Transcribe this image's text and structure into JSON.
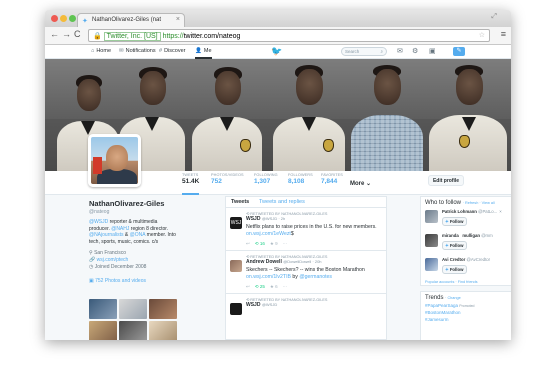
{
  "browser": {
    "tab_title": "NathanOlivarez-Giles (nat",
    "tab_close": "×",
    "back": "←",
    "forward": "→",
    "reload": "C",
    "ev_label": "Twitter, Inc. [US]",
    "url_scheme": "https://",
    "url_rest": "twitter.com/nateog",
    "menu_icon": "≡",
    "colors": {
      "secure": "#2a8d2a"
    }
  },
  "nav": {
    "home": "Home",
    "notifications": "Notifications",
    "discover": "Discover",
    "me": "Me",
    "search_placeholder": "Search"
  },
  "stats": [
    {
      "label": "TWEETS",
      "value": "51.4K"
    },
    {
      "label": "PHOTOS/VIDEOS",
      "value": "752"
    },
    {
      "label": "FOLLOWING",
      "value": "1,307"
    },
    {
      "label": "FOLLOWERS",
      "value": "8,108"
    },
    {
      "label": "FAVORITES",
      "value": "7,844"
    }
  ],
  "more_label": "More",
  "edit_profile": "Edit profile",
  "profile": {
    "name": "NathanOlivarez-Giles",
    "handle": "@nateog",
    "bio_mention1": "@WSJD",
    "bio_text1": " reporter & multimedia producer. ",
    "bio_mention2": "@NAHJ",
    "bio_text2": " region 8 director. ",
    "bio_mention3": "@NAjournalists",
    "bio_text3": " & ",
    "bio_mention4": "@ONA",
    "bio_text4": " member. Into tech, sports, music, comics. c/s",
    "location": "San Francisco",
    "website": "wsj.com/ptech",
    "joined": "Joined December 2008",
    "photos_link": "752 Photos and videos"
  },
  "timeline": {
    "tab_tweets": "Tweets",
    "tab_replies": "Tweets and replies",
    "tweets": [
      {
        "retweet_label": "RETWEETED BY NATHANOLIVAREZ-GILES",
        "name": "WSJD",
        "handle": "@WSJD · 2h",
        "text": "Netflix plans to raise prices in the U.S. for new members. ",
        "link": "on.wsj.com/1eWezt",
        "text_after": "$",
        "rt_count": "16",
        "fav_count": "9"
      },
      {
        "retweet_label": "RETWEETED BY NATHANOLIVAREZ-GILES",
        "name": "Andrew Dowell",
        "handle": "@DowellDowell · 20h",
        "text": "Skechers -- Skechers? -- wins the Boston Marathon ",
        "link": "on.wsj.com/1lv2TIB",
        "text_after": " by ",
        "mention": "@germanotes",
        "rt_count": "25",
        "fav_count": "6"
      },
      {
        "retweet_label": "RETWEETED BY NATHANOLIVAREZ-GILES",
        "name": "WSJD",
        "handle": "@WSJD",
        "text": "",
        "link": "",
        "text_after": "",
        "rt_count": "",
        "fav_count": ""
      }
    ]
  },
  "who_to_follow": {
    "title": "Who to follow",
    "refresh": "· Refresh · View all",
    "follow_label": "Follow",
    "close": "×",
    "suggestions": [
      {
        "name": "Patrick Lohmann",
        "handle": "@PatLo..."
      },
      {
        "name": "miranda",
        "name2": "mulligan",
        "handle": "@mm"
      },
      {
        "name": "Avi Credtor",
        "handle": "@AvCredtor"
      }
    ],
    "footer": "Popular accounts · Find friends"
  },
  "trends": {
    "title": "Trends",
    "change": "· Change",
    "items": [
      {
        "tag": "#PapaPearSaga",
        "promoted": "Promoted"
      },
      {
        "tag": "#BostonMarathon",
        "promoted": ""
      },
      {
        "tag": "#Jamesurm",
        "promoted": ""
      }
    ]
  }
}
